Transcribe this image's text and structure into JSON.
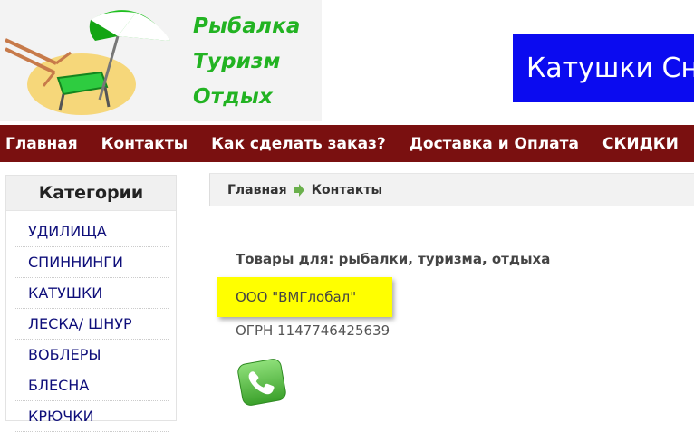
{
  "header": {
    "logo_lines": [
      "Рыбалка",
      "Туризм",
      "Отдых"
    ],
    "banner_text": "Катушки Сн"
  },
  "nav": {
    "items": [
      "Главная",
      "Контакты",
      "Как сделать заказ?",
      "Доставка и Оплата",
      "СКИДКИ"
    ]
  },
  "sidebar": {
    "title": "Категории",
    "items": [
      "УДИЛИЩА",
      "СПИННИНГИ",
      "КАТУШКИ",
      "ЛЕСКА/ ШНУР",
      "ВОБЛЕРЫ",
      "БЛЕСНА",
      "КРЮЧКИ"
    ]
  },
  "breadcrumb": {
    "home": "Главная",
    "current": "Контакты"
  },
  "content": {
    "heading": "Товары для: рыбалки, туризма, отдыха",
    "company": "ООО \"ВМГлобал\"",
    "ogrn": "ОГРН 1147746425639"
  },
  "colors": {
    "nav_bg": "#7a1010",
    "logo_text": "#22b322",
    "banner_bg": "#0b0bf0",
    "company_highlight": "#ffff00",
    "link": "#0e0e7a"
  },
  "icons": {
    "breadcrumb_separator": "green-arrow-icon",
    "contact": "phone-icon"
  }
}
